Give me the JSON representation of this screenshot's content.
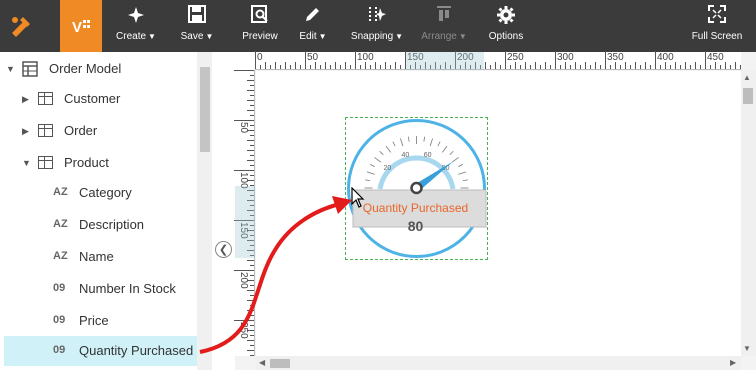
{
  "toolbar": {
    "buttons": [
      {
        "label": "Create",
        "icon": "sparkle-icon",
        "dropdown": true
      },
      {
        "label": "Save",
        "icon": "floppy-icon",
        "dropdown": true
      },
      {
        "label": "Preview",
        "icon": "preview-icon",
        "dropdown": false
      },
      {
        "label": "Edit",
        "icon": "pencil-icon",
        "dropdown": true
      },
      {
        "label": "Snapping",
        "icon": "snapping-icon",
        "dropdown": true
      },
      {
        "label": "Arrange",
        "icon": "arrange-icon",
        "dropdown": true,
        "disabled": true
      },
      {
        "label": "Options",
        "icon": "gear-icon",
        "dropdown": false
      },
      {
        "label": "Full Screen",
        "icon": "fullscreen-icon",
        "dropdown": false
      }
    ],
    "accent_color": "#f08a24"
  },
  "tree": {
    "root": "Order Model",
    "tables": [
      "Customer",
      "Order",
      "Product"
    ],
    "fields": [
      {
        "type": "AZ",
        "name": "Category"
      },
      {
        "type": "AZ",
        "name": "Description"
      },
      {
        "type": "AZ",
        "name": "Name"
      },
      {
        "type": "09",
        "name": "Number In Stock"
      },
      {
        "type": "09",
        "name": "Price"
      },
      {
        "type": "09",
        "name": "Quantity Purchased"
      }
    ],
    "selected": "Quantity Purchased"
  },
  "ruler": {
    "top_labels": [
      "0",
      "50",
      "100",
      "150",
      "200",
      "250",
      "300",
      "350",
      "400",
      "450"
    ],
    "left_labels": [
      "50",
      "100",
      "150",
      "200",
      "250"
    ]
  },
  "gauge": {
    "title": "Quantity Purchased",
    "value": "80",
    "value_number": 80,
    "scale_labels": [
      "20",
      "40",
      "60",
      "80"
    ],
    "ring_color": "#4db3e6",
    "needle_color": "#3aa0dc"
  }
}
